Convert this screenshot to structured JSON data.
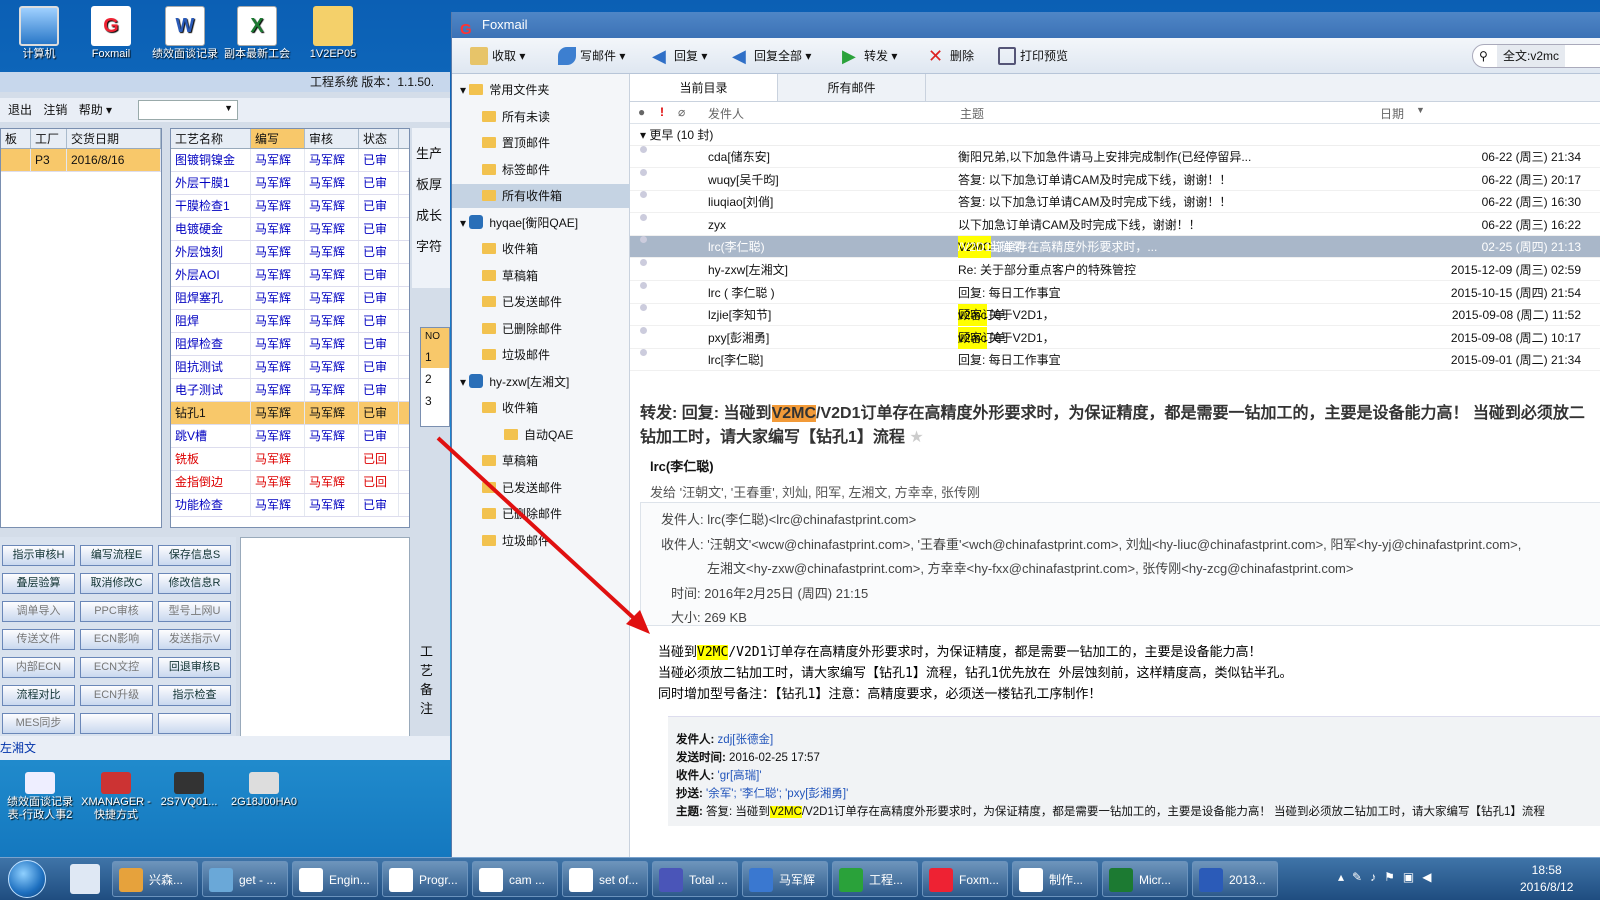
{
  "desktop": {
    "icons": [
      {
        "label": "计算机"
      },
      {
        "label": "Foxmail"
      },
      {
        "label": "绩效面谈记录"
      },
      {
        "label": "副本最新工会"
      },
      {
        "label": "1V2EP05"
      }
    ],
    "bottom_icons": [
      {
        "label": "绩效面谈记录表-行政人事2"
      },
      {
        "label": "XMANAGER - 快捷方式"
      },
      {
        "label": "2S7VQ01..."
      },
      {
        "label": "2G18J00HA0"
      }
    ]
  },
  "app": {
    "title": "工程系统  版本：1.1.50.",
    "menu": [
      "退出",
      "注销",
      "帮助 ▾"
    ],
    "left_headers": [
      "板",
      "工厂",
      "交货日期"
    ],
    "left_row": {
      "factory": "P3",
      "date": "2016/8/16"
    },
    "headers": [
      "工艺名称",
      "编写",
      "审核",
      "状态"
    ],
    "rows": [
      {
        "name": "图镀铜镍金",
        "w": "马军辉",
        "r": "马军辉",
        "s": "已审",
        "c": "blue"
      },
      {
        "name": "外层干膜1",
        "w": "马军辉",
        "r": "马军辉",
        "s": "已审",
        "c": "blue"
      },
      {
        "name": "干膜检查1",
        "w": "马军辉",
        "r": "马军辉",
        "s": "已审",
        "c": "blue"
      },
      {
        "name": "电镀硬金",
        "w": "马军辉",
        "r": "马军辉",
        "s": "已审",
        "c": "blue"
      },
      {
        "name": "外层蚀刻",
        "w": "马军辉",
        "r": "马军辉",
        "s": "已审",
        "c": "blue"
      },
      {
        "name": "外层AOI",
        "w": "马军辉",
        "r": "马军辉",
        "s": "已审",
        "c": "blue"
      },
      {
        "name": "阻焊塞孔",
        "w": "马军辉",
        "r": "马军辉",
        "s": "已审",
        "c": "blue"
      },
      {
        "name": "阻焊",
        "w": "马军辉",
        "r": "马军辉",
        "s": "已审",
        "c": "blue"
      },
      {
        "name": "阻焊检查",
        "w": "马军辉",
        "r": "马军辉",
        "s": "已审",
        "c": "blue"
      },
      {
        "name": "阻抗测试",
        "w": "马军辉",
        "r": "马军辉",
        "s": "已审",
        "c": "blue"
      },
      {
        "name": "电子测试",
        "w": "马军辉",
        "r": "马军辉",
        "s": "已审",
        "c": "blue"
      },
      {
        "name": "钻孔1",
        "w": "马军辉",
        "r": "马军辉",
        "s": "已审",
        "c": "sel"
      },
      {
        "name": "跳V槽",
        "w": "马军辉",
        "r": "马军辉",
        "s": "已审",
        "c": "blue"
      },
      {
        "name": "铣板",
        "w": "马军辉",
        "r": "",
        "s": "已回",
        "c": "red"
      },
      {
        "name": "金指倒边",
        "w": "马军辉",
        "r": "马军辉",
        "s": "已回",
        "c": "red"
      },
      {
        "name": "功能检查",
        "w": "马军辉",
        "r": "马军辉",
        "s": "已审",
        "c": "blue"
      }
    ],
    "side_labels": [
      "生产",
      "板厚",
      "成长",
      "字符"
    ],
    "no_header": "NO",
    "no_rows": [
      "1",
      "2",
      "3"
    ],
    "notes_label": "工艺备注",
    "buttons": [
      [
        "指示审核H",
        "编写流程E",
        "保存信息S"
      ],
      [
        "叠层验算",
        "取消修改C",
        "修改信息R"
      ],
      [
        "调单导入",
        "PPC审核",
        "型号上网U"
      ],
      [
        "传送文件",
        "ECN影响",
        "发送指示V"
      ],
      [
        "内部ECN",
        "ECN文控",
        "回退审核B"
      ],
      [
        "流程对比",
        "ECN升级",
        "指示检查"
      ],
      [
        "MES同步",
        "",
        ""
      ]
    ],
    "status_user": "左湘文"
  },
  "foxmail": {
    "title": "Foxmail",
    "toolbar": [
      "收取",
      "写邮件",
      "回复",
      "回复全部",
      "转发",
      "删除",
      "打印预览"
    ],
    "search": {
      "value": "全文:v2mc"
    },
    "tree": [
      {
        "label": "常用文件夹",
        "lvl": 0,
        "type": "hdr"
      },
      {
        "label": "所有未读",
        "lvl": 1
      },
      {
        "label": "置顶邮件",
        "lvl": 1
      },
      {
        "label": "标签邮件",
        "lvl": 1
      },
      {
        "label": "所有收件箱",
        "lvl": 1,
        "active": true
      },
      {
        "label": "hyqae[衡阳QAE]",
        "lvl": 0,
        "type": "acct"
      },
      {
        "label": "收件箱",
        "lvl": 1
      },
      {
        "label": "草稿箱",
        "lvl": 1
      },
      {
        "label": "已发送邮件",
        "lvl": 1
      },
      {
        "label": "已删除邮件",
        "lvl": 1
      },
      {
        "label": "垃圾邮件",
        "lvl": 1
      },
      {
        "label": "hy-zxw[左湘文]",
        "lvl": 0,
        "type": "acct"
      },
      {
        "label": "收件箱",
        "lvl": 1
      },
      {
        "label": "自动QAE",
        "lvl": 2
      },
      {
        "label": "草稿箱",
        "lvl": 1
      },
      {
        "label": "已发送邮件",
        "lvl": 1
      },
      {
        "label": "已删除邮件",
        "lvl": 1
      },
      {
        "label": "垃圾邮件",
        "lvl": 1
      }
    ],
    "tabs": [
      "当前目录",
      "所有邮件"
    ],
    "list_headers": {
      "from": "发件人",
      "subject": "主题",
      "date": "日期"
    },
    "group": "更早 (10 封)",
    "mails": [
      {
        "from": "cda[储东安]",
        "pre": "衡阳兄弟,以下加急件请马上安排完成制作(已经停留异...",
        "hl": "",
        "post": "",
        "date": "06-22 (周三) 21:34"
      },
      {
        "from": "wuqy[吴千昀]",
        "pre": "答复: 以下加急订单请CAM及时完成下线，谢谢！！",
        "hl": "",
        "post": "",
        "date": "06-22 (周三) 20:17"
      },
      {
        "from": "liuqiao[刘俏]",
        "pre": "答复: 以下加急订单请CAM及时完成下线，谢谢！！",
        "hl": "",
        "post": "",
        "date": "06-22 (周三) 16:30"
      },
      {
        "from": "zyx",
        "pre": "以下加急订单请CAM及时完成下线，谢谢！！",
        "hl": "",
        "post": "",
        "date": "06-22 (周三) 16:22"
      },
      {
        "from": "lrc(李仁聪)",
        "pre": "转发: 当碰到",
        "hl": "V2MC",
        "post": "/V2D1订单存在高精度外形要求时，...",
        "date": "02-25 (周四) 21:13",
        "sel": true
      },
      {
        "from": "hy-zxw[左湘文]",
        "pre": "Re: 关于部分重点客户的特殊管控",
        "hl": "",
        "post": "",
        "date": "2015-12-09 (周三) 02:59"
      },
      {
        "from": "lrc ( 李仁聪 )",
        "pre": "回复: 每日工作事宜",
        "hl": "",
        "post": "",
        "date": "2015-10-15 (周四) 21:54"
      },
      {
        "from": "lzjie[李知节]",
        "pre": "回复: 关于V2D1，",
        "hl": "v2mc",
        "post": "顾客订单",
        "date": "2015-09-08 (周二) 11:52"
      },
      {
        "from": "pxy[彭湘勇]",
        "pre": "转发: 关于V2D1，",
        "hl": "v2mc",
        "post": "顾客订单",
        "date": "2015-09-08 (周二) 10:17"
      },
      {
        "from": "lrc[李仁聪]",
        "pre": "回复: 每日工作事宜",
        "hl": "",
        "post": "",
        "date": "2015-09-01 (周二) 21:34"
      }
    ],
    "preview": {
      "subject_pre": "转发: 回复: 当碰到",
      "subject_hl": "V2MC",
      "subject_post": "/V2D1订单存在高精度外形要求时，为保证精度，都是需要一钻加工的，主要是设备能力高！ 当碰到必须放二钻加工时，请大家编写【钻孔1】流程",
      "sender_name": "lrc(李仁聪)",
      "sent_to": "发给 '汪朝文', '王春重', 刘灿, 阳军, 左湘文, 方幸幸, 张传刚",
      "from_line": "发件人: lrc(李仁聪)<lrc@chinafastprint.com>",
      "to_line1": "收件人: '汪朝文'<wcw@chinafastprint.com>, '王春重'<wch@chinafastprint.com>, 刘灿<hy-liuc@chinafastprint.com>, 阳军<hy-yj@chinafastprint.com>,",
      "to_line2": "左湘文<hy-zxw@chinafastprint.com>, 方幸幸<hy-fxx@chinafastprint.com>, 张传刚<hy-zcg@chinafastprint.com>",
      "time_line": "时间: 2016年2月25日 (周四) 21:15",
      "size_line": "大小: 269 KB",
      "body1_pre": "当碰到",
      "body1_hl": "V2MC",
      "body1_post": "/V2D1订单存在高精度外形要求时，为保证精度，都是需要一钻加工的，主要是设备能力高！",
      "body2": "当碰必须放二钻加工时，请大家编写【钻孔1】流程，钻孔1优先放在 外层蚀刻前，这样精度高，类似钻半孔。",
      "body3": "同时增加型号备注：【钻孔1】注意：高精度要求，必须送一楼钻孔工序制作！",
      "q_from_l": "发件人:",
      "q_from": "zdj[张德金]",
      "q_time_l": "发送时间:",
      "q_time": "2016-02-25 17:57",
      "q_to_l": "收件人:",
      "q_to": "'gr[高瑞]'",
      "q_cc_l": "抄送:",
      "q_cc": "'余军'; '李仁聪'; 'pxy[彭湘勇]'",
      "q_subj_l": "主题:",
      "q_subj_pre": "答复: 当碰到",
      "q_subj_hl": "V2MC",
      "q_subj_post": "/V2D1订单存在高精度外形要求时，为保证精度，都是需要一钻加工的，主要是设备能力高！ 当碰到必须放二钻加工时，请大家编写【钻孔1】流程"
    }
  },
  "taskbar": {
    "items": [
      "兴森...",
      "get - ...",
      "Engin...",
      "Progr...",
      "cam ...",
      "set of...",
      "Total ...",
      "马军辉",
      "工程...",
      "Foxm...",
      "制作...",
      "Micr...",
      "2013..."
    ],
    "time": "18:58",
    "date": "2016/8/12"
  }
}
